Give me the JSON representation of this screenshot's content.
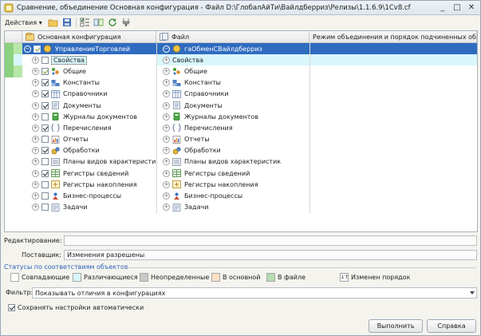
{
  "window": {
    "title": "Сравнение, объединение Основная конфигурация - Файл D:\\ГлобалАйТи\\Вайлдберриз\\Релизы\\1.1.6.9\\1Cv8.cf",
    "minimize": "_",
    "maximize": "□",
    "close": "✕"
  },
  "toolbar": {
    "actions_label": "Действия ▾"
  },
  "columns": {
    "main": "Основная конфигурация",
    "file": "Файл",
    "mode": "Режим объединения и порядок подчиненных объек..."
  },
  "tree": {
    "root_main": "УправлениеТорговлей",
    "root_file": "гаОбменСВайлдберриз",
    "items": [
      {
        "label": "Свойства",
        "checked": false,
        "icon": "properties-icon"
      },
      {
        "label": "Общие",
        "checked": "partial",
        "icon": "common-icon"
      },
      {
        "label": "Константы",
        "checked": true,
        "icon": "constants-icon"
      },
      {
        "label": "Справочники",
        "checked": true,
        "icon": "catalogs-icon"
      },
      {
        "label": "Документы",
        "checked": true,
        "icon": "documents-icon"
      },
      {
        "label": "Журналы документов",
        "checked": false,
        "icon": "journals-icon"
      },
      {
        "label": "Перечисления",
        "checked": true,
        "icon": "enums-icon"
      },
      {
        "label": "Отчеты",
        "checked": false,
        "icon": "reports-icon"
      },
      {
        "label": "Обработки",
        "checked": true,
        "icon": "processing-icon"
      },
      {
        "label": "Планы видов характеристик",
        "checked": false,
        "icon": "chart-types-icon"
      },
      {
        "label": "Регистры сведений",
        "checked": true,
        "icon": "info-registers-icon"
      },
      {
        "label": "Регистры накопления",
        "checked": false,
        "icon": "accum-registers-icon"
      },
      {
        "label": "Бизнес-процессы",
        "checked": false,
        "icon": "business-process-icon"
      },
      {
        "label": "Задачи",
        "checked": false,
        "icon": "tasks-icon"
      }
    ],
    "file_items": [
      "Свойства",
      "Общие",
      "Константы",
      "Справочники",
      "Документы",
      "Журналы документов",
      "Перечисления",
      "Отчеты",
      "Обработки",
      "Планы видов характеристик",
      "Регистры сведений",
      "Регистры накопления",
      "Бизнес-процессы",
      "Задачи"
    ]
  },
  "form": {
    "editing_label": "Редактирование:",
    "editing_value": "",
    "supplier_label": "Поставщик:",
    "supplier_value": "Изменения разрешены"
  },
  "statuses": {
    "title": "Статусы по соответствиям объектов",
    "items": [
      {
        "label": "Совпадающие",
        "color": "#ffffff"
      },
      {
        "label": "Различающиеся",
        "color": "#d9f7fb"
      },
      {
        "label": "Неопределенные",
        "color": "#c9c9c9"
      },
      {
        "label": "В основной",
        "color": "#fde0c4"
      },
      {
        "label": "В файле",
        "color": "#b7dcb3"
      }
    ],
    "order_label": "Изменен порядок",
    "order_icon_text": "↓↑"
  },
  "filter": {
    "label": "Фильтр:",
    "value": "Показывать отличия в конфигурациях"
  },
  "autosave": {
    "label": "Сохранять настройки автоматически",
    "checked": true
  },
  "buttons": {
    "run": "Выполнить",
    "help": "Справка"
  },
  "colors": {
    "selection": "#2f6bbf",
    "accent_blue": "#2a61b8",
    "mark_green": "#8cd17f"
  }
}
